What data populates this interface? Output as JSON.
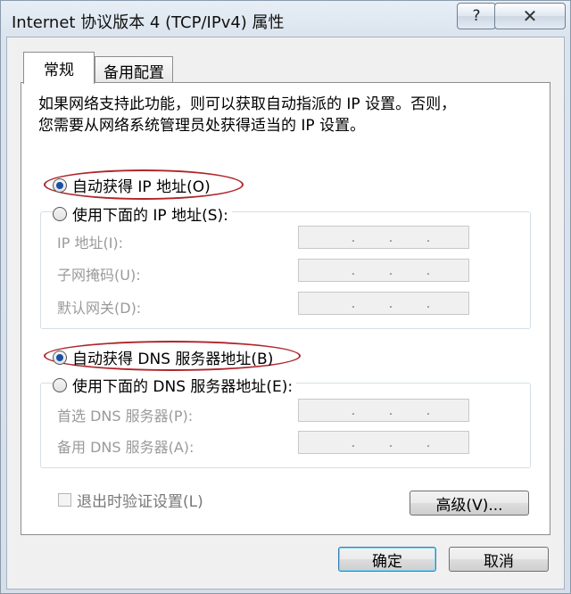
{
  "window": {
    "title": "Internet 协议版本 4 (TCP/IPv4) 属性",
    "help_label": "?",
    "close_label": "✕"
  },
  "tabs": [
    {
      "label": "常规",
      "active": true
    },
    {
      "label": "备用配置",
      "active": false
    }
  ],
  "description": {
    "line1": "如果网络支持此功能，则可以获取自动指派的 IP 设置。否则，",
    "line2": "您需要从网络系统管理员处获得适当的 IP 设置。"
  },
  "ip": {
    "auto_label": "自动获得 IP 地址(O)",
    "auto_selected": true,
    "manual_label": "使用下面的 IP 地址(S):",
    "manual_selected": false,
    "fields": [
      {
        "label": "IP 地址(I):",
        "value": ". . ."
      },
      {
        "label": "子网掩码(U):",
        "value": ". . ."
      },
      {
        "label": "默认网关(D):",
        "value": ". . ."
      }
    ]
  },
  "dns": {
    "auto_label": "自动获得 DNS 服务器地址(B)",
    "auto_selected": true,
    "manual_label": "使用下面的 DNS 服务器地址(E):",
    "manual_selected": false,
    "fields": [
      {
        "label": "首选 DNS 服务器(P):",
        "value": ". . ."
      },
      {
        "label": "备用 DNS 服务器(A):",
        "value": ". . ."
      }
    ]
  },
  "validate": {
    "label": "退出时验证设置(L)",
    "checked": false
  },
  "buttons": {
    "advanced": "高级(V)...",
    "ok": "确定",
    "cancel": "取消"
  },
  "colors": {
    "highlight_ellipse": "#b0262c",
    "radio_selected": "#1c4fa3"
  }
}
